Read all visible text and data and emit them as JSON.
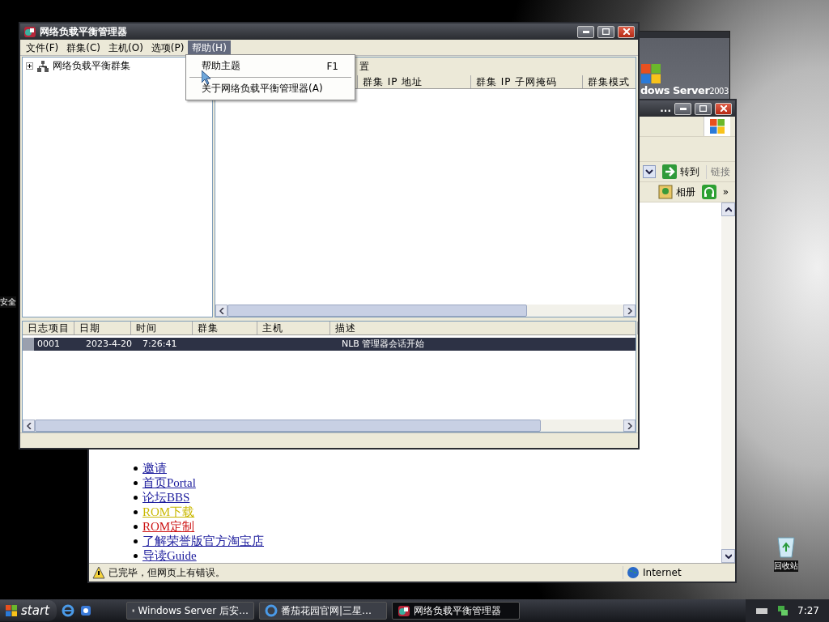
{
  "desktop": {
    "icons": [
      {
        "label": "安全"
      },
      {
        "label": "回收站"
      }
    ]
  },
  "server_banner": {
    "brand": "dows Server",
    "version": "2003"
  },
  "browser": {
    "title": "...",
    "go_button": "转到",
    "links_label": "链接",
    "toolbar_items": [
      {
        "kind": "photo",
        "label": "相册"
      },
      {
        "kind": "headset"
      }
    ],
    "more": "»",
    "links": [
      {
        "text": "邀请",
        "color": "#1a1a9c"
      },
      {
        "text": "首页Portal",
        "color": "#1a1a9c"
      },
      {
        "text": "论坛BBS",
        "color": "#1a1a9c"
      },
      {
        "text": "ROM下载",
        "color": "#c9b800"
      },
      {
        "text": "ROM定制",
        "color": "#cc1111"
      },
      {
        "text": "了解荣誉版官方淘宝店",
        "color": "#1a1a9c"
      },
      {
        "text": "导读Guide",
        "color": "#1a1a9c"
      }
    ],
    "status": "已完毕，但网页上有错误。",
    "zone": "Internet"
  },
  "nlb": {
    "title": "网络负载平衡管理器",
    "menu": [
      {
        "label": "文件(F)",
        "selected": false
      },
      {
        "label": "群集(C)",
        "selected": false
      },
      {
        "label": "主机(O)",
        "selected": false
      },
      {
        "label": "选项(P)",
        "selected": false
      },
      {
        "label": "帮助(H)",
        "selected": true
      }
    ],
    "tree": [
      {
        "label": "网络负载平衡群集",
        "expanded": false
      }
    ],
    "detail_caption": "置",
    "columns": [
      "群集 IP 地址",
      "群集 IP 子网掩码",
      "群集模式"
    ],
    "log_columns": [
      "日志项目",
      "日期",
      "时间",
      "群集",
      "主机",
      "描述"
    ],
    "log_rows": [
      {
        "entry": "0001",
        "date": "2023-4-20",
        "time": "7:26:41",
        "description": "NLB 管理器会话开始",
        "selected": true
      }
    ],
    "help_menu": [
      {
        "kind": "item",
        "label": "帮助主题",
        "shortcut": "F1"
      },
      {
        "kind": "separator"
      },
      {
        "kind": "item",
        "label": "关于网络负载平衡管理器(A)"
      }
    ]
  },
  "taskbar": {
    "start": "start",
    "tasks": [
      {
        "label": "Windows Server 后安…",
        "kind": "server",
        "selected": false
      },
      {
        "label": "番茄花园官网|三星…",
        "kind": "ie",
        "selected": false
      },
      {
        "label": "网络负载平衡管理器",
        "kind": "nlb",
        "selected": true
      }
    ],
    "clock": "7:27"
  }
}
